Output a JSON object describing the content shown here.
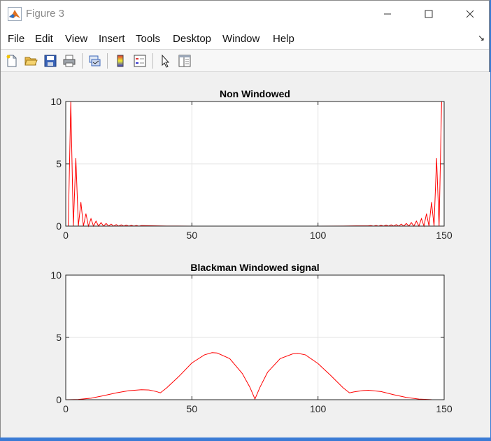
{
  "window": {
    "title": "Figure 3",
    "app_icon": "matlab-logo-icon"
  },
  "menu": {
    "items": [
      "File",
      "Edit",
      "View",
      "Insert",
      "Tools",
      "Desktop",
      "Window",
      "Help"
    ],
    "overflow_icon": "dock-arrow-icon"
  },
  "toolbar": {
    "tools": [
      "new-figure-icon",
      "open-file-icon",
      "save-figure-icon",
      "print-figure-icon",
      "link-plot-icon",
      "insert-colorbar-icon",
      "insert-legend-icon",
      "edit-plot-cursor-icon",
      "open-property-inspector-icon"
    ]
  },
  "chart_data": [
    {
      "type": "line",
      "title": "Non Windowed",
      "xlim": [
        0,
        150
      ],
      "ylim": [
        0,
        10
      ],
      "xticks": [
        0,
        50,
        100,
        150
      ],
      "yticks": [
        0,
        5,
        10
      ],
      "grid": true,
      "series": [
        {
          "color": "#ff0000",
          "x": [
            1,
            2,
            3,
            4,
            5,
            6,
            7,
            8,
            9,
            10,
            11,
            12,
            13,
            14,
            15,
            16,
            17,
            18,
            19,
            20,
            21,
            22,
            23,
            24,
            25,
            26,
            27,
            28,
            29,
            30,
            40,
            50,
            60,
            70,
            75,
            80,
            90,
            100,
            110,
            120,
            121,
            122,
            123,
            124,
            125,
            126,
            127,
            128,
            129,
            130,
            131,
            132,
            133,
            134,
            135,
            136,
            137,
            138,
            139,
            140,
            141,
            142,
            143,
            144,
            145,
            146,
            147,
            148,
            149
          ],
          "y": [
            0,
            10,
            0,
            5.45,
            0,
            1.92,
            0,
            1.0,
            0,
            0.6,
            0,
            0.4,
            0,
            0.28,
            0,
            0.21,
            0,
            0.16,
            0,
            0.12,
            0,
            0.1,
            0,
            0.08,
            0,
            0.06,
            0,
            0.05,
            0,
            0.04,
            0.01,
            0,
            0,
            0,
            0,
            0,
            0,
            0,
            0.01,
            0.03,
            0.04,
            0,
            0.05,
            0,
            0.06,
            0,
            0.08,
            0,
            0.1,
            0,
            0.12,
            0,
            0.16,
            0,
            0.21,
            0,
            0.28,
            0,
            0.4,
            0,
            0.6,
            0,
            1.0,
            0,
            1.92,
            0,
            5.45,
            0,
            10
          ]
        }
      ]
    },
    {
      "type": "line",
      "title": "Blackman Windowed signal",
      "xlim": [
        0,
        150
      ],
      "ylim": [
        0,
        10
      ],
      "xticks": [
        0,
        50,
        100,
        150
      ],
      "yticks": [
        0,
        5,
        10
      ],
      "grid": true,
      "series": [
        {
          "color": "#ff0000",
          "x": [
            0,
            5,
            10,
            15,
            20,
            25,
            30,
            33,
            36,
            37.5,
            40,
            45,
            50,
            55,
            58,
            60,
            65,
            70,
            73,
            75,
            77,
            80,
            85,
            90,
            92,
            95,
            100,
            105,
            110,
            112.5,
            114,
            118,
            120,
            125,
            130,
            135,
            140,
            145,
            150
          ],
          "y": [
            0,
            0.02,
            0.12,
            0.32,
            0.55,
            0.72,
            0.8,
            0.78,
            0.65,
            0.55,
            0.95,
            1.9,
            2.95,
            3.6,
            3.78,
            3.75,
            3.3,
            2.1,
            1.0,
            0.05,
            1.0,
            2.2,
            3.3,
            3.68,
            3.72,
            3.6,
            2.9,
            1.95,
            0.95,
            0.55,
            0.62,
            0.74,
            0.76,
            0.65,
            0.4,
            0.18,
            0.05,
            0.01,
            0
          ]
        }
      ]
    }
  ]
}
